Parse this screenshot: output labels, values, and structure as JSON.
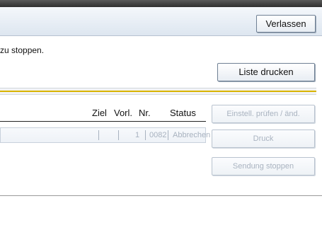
{
  "header": {
    "exit_label": "Verlassen"
  },
  "message": {
    "text": "zu stoppen."
  },
  "toolbar": {
    "print_list_label": "Liste drucken"
  },
  "table": {
    "columns": [
      "Ziel",
      "Vorl.",
      "Nr.",
      "Status"
    ],
    "rows": [
      {
        "ziel": "",
        "vorl": "1",
        "nr": "0082",
        "status": "Abbrechen"
      }
    ]
  },
  "side_buttons": {
    "settings_label": "Einstell. prüfen / änd.",
    "druck_label": "Druck",
    "stop_label": "Sendung stoppen"
  },
  "colors": {
    "accent_line": "#d8b400",
    "topbar": "#3a3a3a"
  }
}
